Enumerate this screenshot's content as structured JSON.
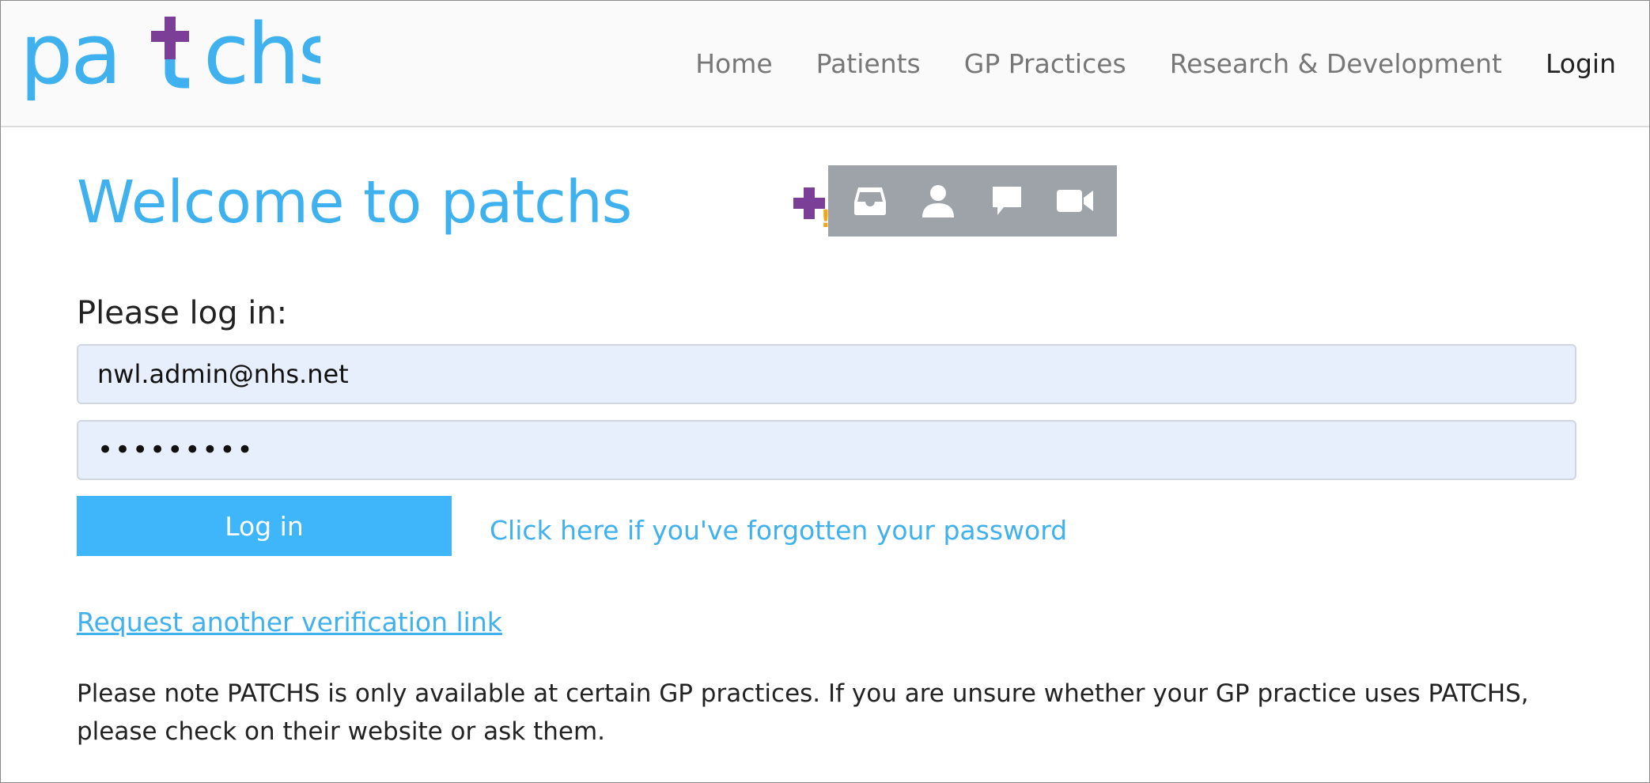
{
  "header": {
    "logo_text": "patchs",
    "nav": [
      {
        "label": "Home"
      },
      {
        "label": "Patients"
      },
      {
        "label": "GP Practices"
      },
      {
        "label": "Research & Development"
      },
      {
        "label": "Login"
      }
    ]
  },
  "main": {
    "welcome_prefix": "Welcome to",
    "welcome_brand": "patchs",
    "prompt": "Please log in:",
    "email_value": "nwl.admin@nhs.net",
    "password_value": "•••••••••",
    "login_button": "Log in",
    "forgot_link": "Click here if you've forgotten your password",
    "verify_link": "Request another verification link",
    "note": "Please note PATCHS is only available at certain GP practices. If you are unsure whether your GP practice uses PATCHS, please check on their website or ask them."
  },
  "toolbar": {
    "exclaim": "!",
    "icons": [
      "inbox-icon",
      "user-icon",
      "chat-icon",
      "video-icon"
    ]
  },
  "colors": {
    "brand_blue": "#3fb1ef",
    "brand_purple": "#7b3f98",
    "warning_orange": "#f2a516",
    "toolbar_grey": "#9ea3aa",
    "field_bg": "#e8effc",
    "button_blue": "#3fb5fa"
  }
}
